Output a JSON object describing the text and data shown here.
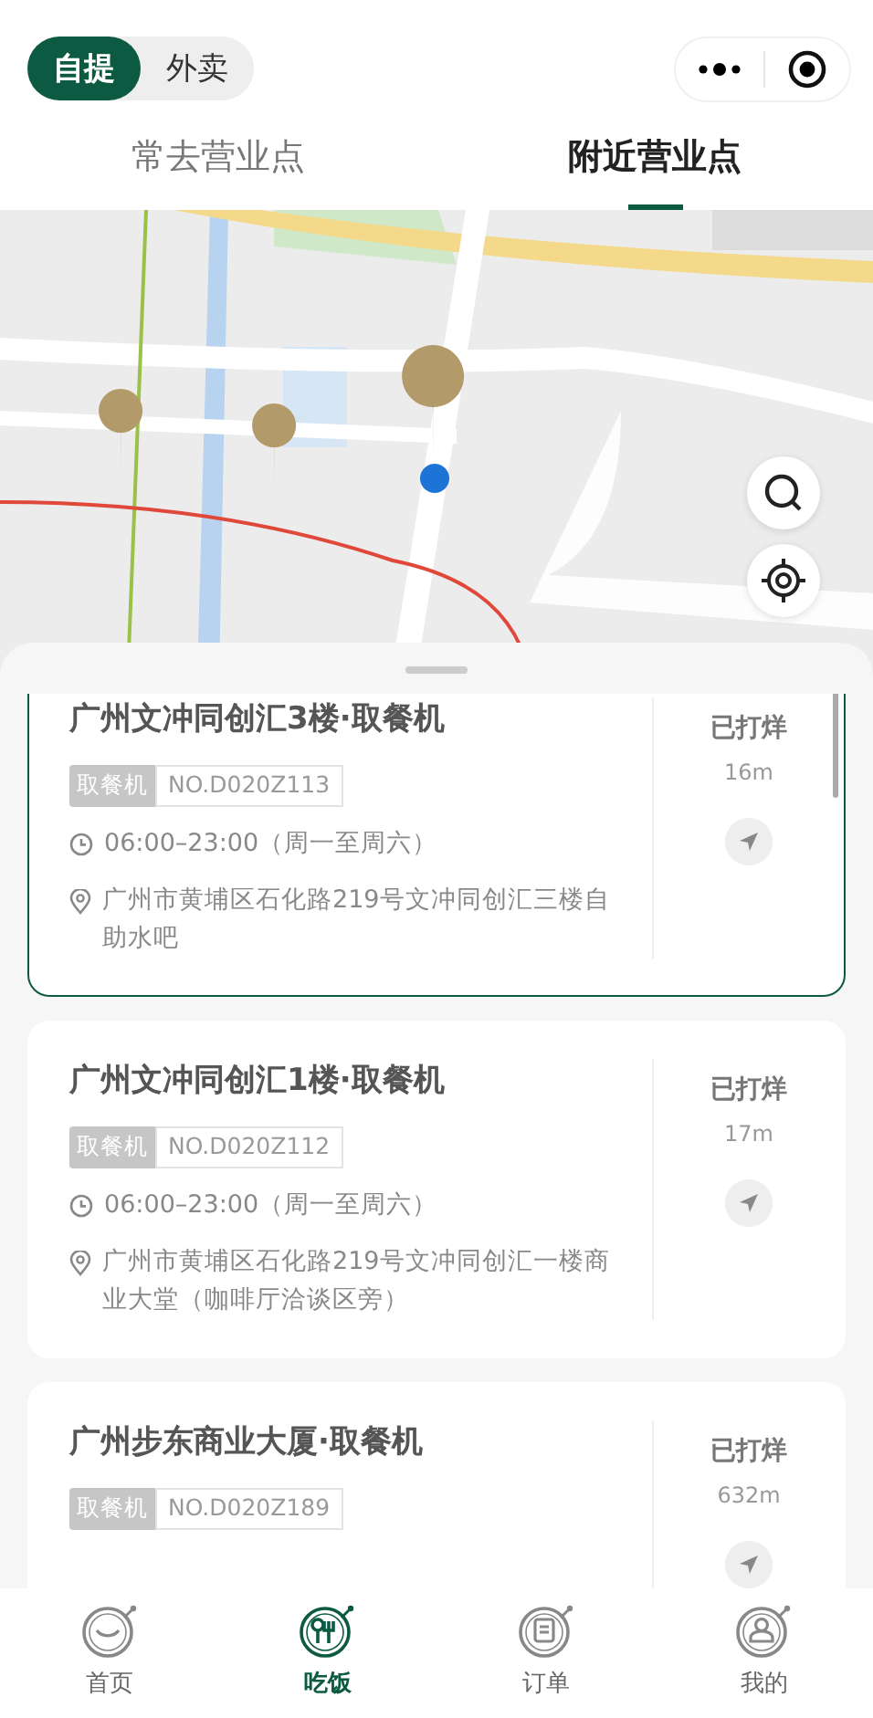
{
  "mode_toggle": [
    {
      "label": "自提",
      "selected": true
    },
    {
      "label": "外卖",
      "selected": false
    }
  ],
  "tabs": [
    {
      "label": "常去营业点",
      "selected": false
    },
    {
      "label": "附近营业点",
      "selected": true
    }
  ],
  "stores": [
    {
      "name": "广州文冲同创汇3楼·取餐机",
      "type_tag": "取餐机",
      "code": "NO.D020Z113",
      "hours": "06:00–23:00（周一至周六）",
      "address": "广州市黄埔区石化路219号文冲同创汇三楼自助水吧",
      "status": "已打烊",
      "distance": "16m",
      "selected": true
    },
    {
      "name": "广州文冲同创汇1楼·取餐机",
      "type_tag": "取餐机",
      "code": "NO.D020Z112",
      "hours": "06:00–23:00（周一至周六）",
      "address": "广州市黄埔区石化路219号文冲同创汇一楼商业大堂（咖啡厅洽谈区旁）",
      "status": "已打烊",
      "distance": "17m",
      "selected": false
    },
    {
      "name": "广州步东商业大厦·取餐机",
      "type_tag": "取餐机",
      "code": "NO.D020Z189",
      "status": "已打烊",
      "distance": "632m",
      "selected": false
    }
  ],
  "bottom_nav": [
    {
      "label": "首页",
      "kind": "home",
      "selected": false
    },
    {
      "label": "吃饭",
      "kind": "dine",
      "selected": true
    },
    {
      "label": "订单",
      "kind": "orders",
      "selected": false
    },
    {
      "label": "我的",
      "kind": "profile",
      "selected": false
    }
  ]
}
